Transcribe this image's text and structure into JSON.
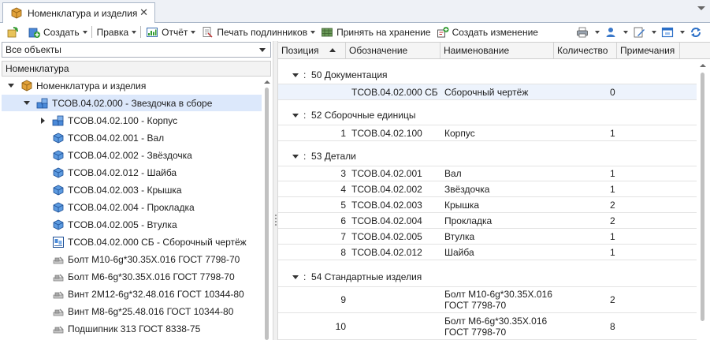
{
  "tab": {
    "title": "Номенклатура и изделия",
    "close": "✕"
  },
  "toolbar": {
    "create": "Создать",
    "edit": "Правка",
    "report": "Отчёт",
    "print_originals": "Печать подлинников",
    "accept_storage": "Принять на хранение",
    "create_change": "Создать изменение"
  },
  "filter": {
    "value": "Все объекты"
  },
  "left_panel": {
    "header": "Номенклатура"
  },
  "tree": {
    "root": "Номенклатура и изделия",
    "assembly": "ТСОВ.04.02.000 - Звездочка в сборе",
    "items": [
      "ТСОВ.04.02.100 - Корпус",
      "ТСОВ.04.02.001 - Вал",
      "ТСОВ.04.02.002 - Звёздочка",
      "ТСОВ.04.02.012 - Шайба",
      "ТСОВ.04.02.003 - Крышка",
      "ТСОВ.04.02.004 - Прокладка",
      "ТСОВ.04.02.005 - Втулка",
      "ТСОВ.04.02.000 СБ - Сборочный чертёж",
      "Болт М10-6g*30.35Х.016 ГОСТ 7798-70",
      "Болт М6-6g*30.35Х.016 ГОСТ 7798-70",
      "Винт 2М12-6g*32.48.016 ГОСТ 10344-80",
      "Винт М8-6g*25.48.016 ГОСТ 10344-80",
      "Подшипник 313 ГОСТ 8338-75"
    ]
  },
  "table": {
    "columns": [
      "Позиция",
      "Обозначение",
      "Наименование",
      "Количество",
      "Примечания"
    ],
    "groups": [
      {
        "title": "50 Документация",
        "rows": [
          {
            "pos": "",
            "designation": "ТСОВ.04.02.000 СБ",
            "name": "Сборочный чертёж",
            "qty": "0"
          }
        ]
      },
      {
        "title": "52 Сборочные единицы",
        "rows": [
          {
            "pos": "1",
            "designation": "ТСОВ.04.02.100",
            "name": "Корпус",
            "qty": "1"
          }
        ]
      },
      {
        "title": "53 Детали",
        "rows": [
          {
            "pos": "3",
            "designation": "ТСОВ.04.02.001",
            "name": "Вал",
            "qty": "1"
          },
          {
            "pos": "4",
            "designation": "ТСОВ.04.02.002",
            "name": "Звёздочка",
            "qty": "1"
          },
          {
            "pos": "5",
            "designation": "ТСОВ.04.02.003",
            "name": "Крышка",
            "qty": "2"
          },
          {
            "pos": "6",
            "designation": "ТСОВ.04.02.004",
            "name": "Прокладка",
            "qty": "2"
          },
          {
            "pos": "7",
            "designation": "ТСОВ.04.02.005",
            "name": "Втулка",
            "qty": "1"
          },
          {
            "pos": "8",
            "designation": "ТСОВ.04.02.012",
            "name": "Шайба",
            "qty": "1"
          }
        ]
      },
      {
        "title": "54 Стандартные изделия",
        "rows": [
          {
            "pos": "9",
            "designation": "",
            "name": "Болт М10-6g*30.35Х.016 ГОСТ 7798-70",
            "qty": "2"
          },
          {
            "pos": "10",
            "designation": "",
            "name": "Болт М6-6g*30.35Х.016 ГОСТ 7798-70",
            "qty": "8"
          }
        ]
      }
    ]
  },
  "group_prefix": ":",
  "icons": {
    "tab": "product-icon",
    "create": "create-icon",
    "print": "print-icon",
    "part": "part-icon",
    "assembly": "assembly-icon",
    "drawing": "drawing-icon",
    "standard": "standard-part-icon"
  },
  "colors": {
    "selection": "#dce8fb",
    "row_selection": "#edf3fc",
    "accent": "#2b6fc7"
  }
}
